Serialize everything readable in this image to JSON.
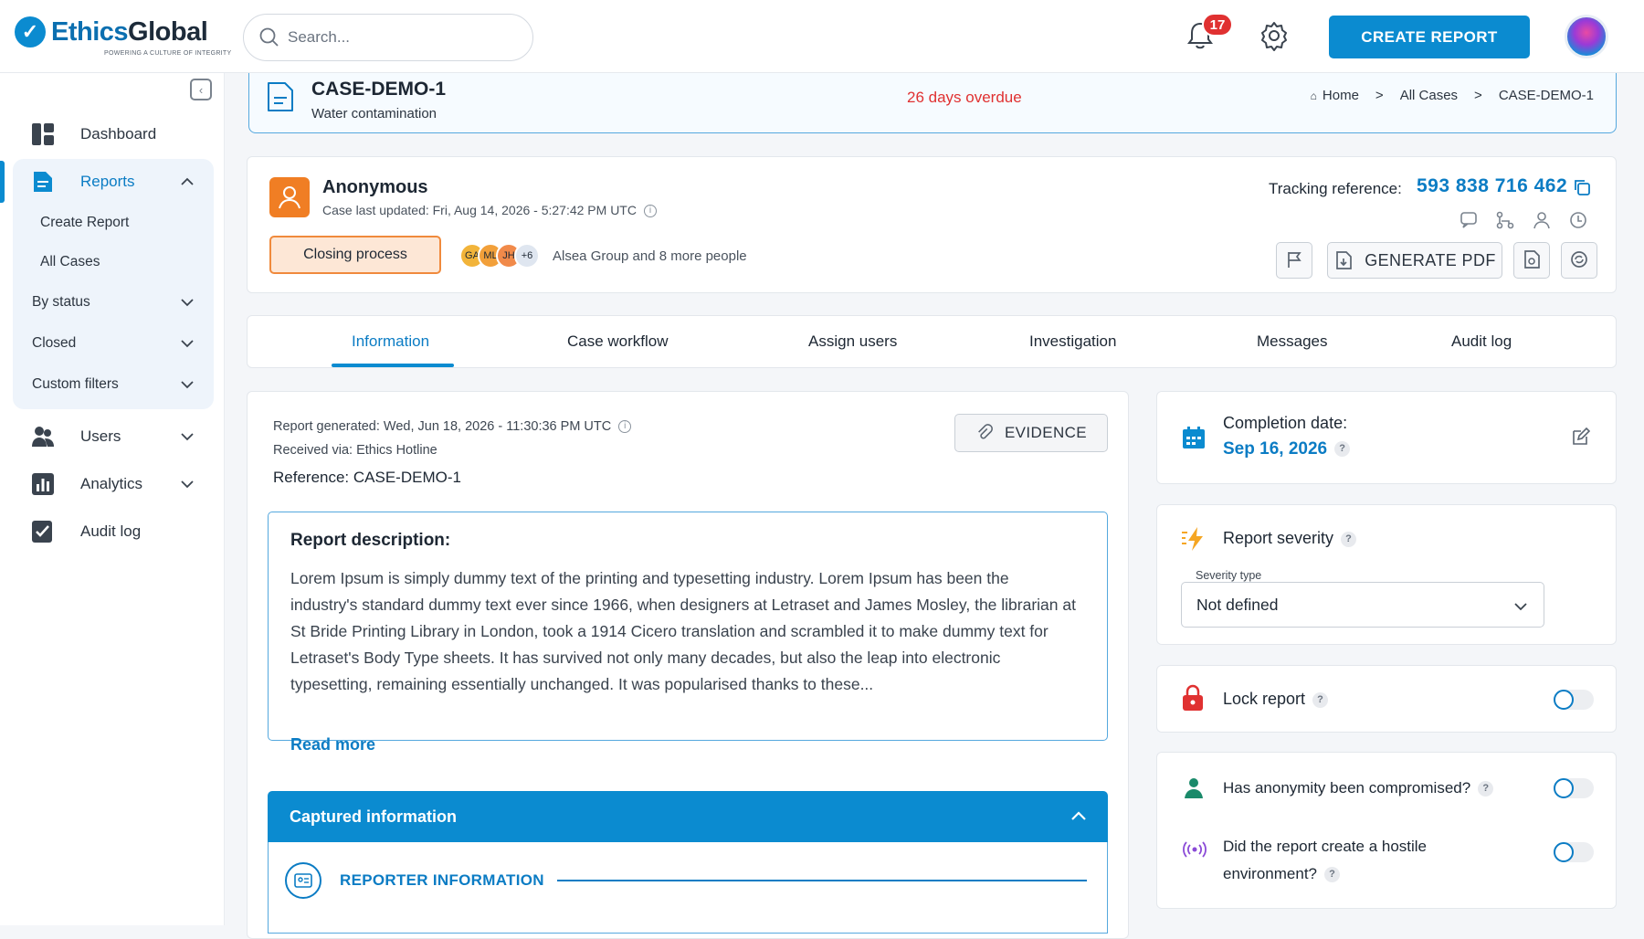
{
  "brand": {
    "name_a": "Ethics",
    "name_b": "Global",
    "tagline": "POWERING A CULTURE OF INTEGRITY"
  },
  "header": {
    "search_placeholder": "Search...",
    "notifications": "17",
    "create_report": "CREATE REPORT"
  },
  "sidebar": {
    "dashboard": "Dashboard",
    "reports": "Reports",
    "create_report": "Create Report",
    "all_cases": "All Cases",
    "by_status": "By status",
    "closed": "Closed",
    "custom_filters": "Custom filters",
    "users": "Users",
    "analytics": "Analytics",
    "audit_log": "Audit log"
  },
  "case": {
    "id": "CASE-DEMO-1",
    "subtitle": "Water contamination",
    "overdue": "26 days overdue",
    "breadcrumb": [
      "Home",
      ">",
      "All Cases",
      ">",
      "CASE-DEMO-1"
    ]
  },
  "summary": {
    "reporter": "Anonymous",
    "updated": "Case last updated: Fri, Aug 14, 2026 - 5:27:42 PM UTC",
    "status": "Closing process",
    "chips": [
      "GA",
      "ML",
      "JH",
      "+6"
    ],
    "people": "Alsea Group and 8 more people",
    "tracking_label": "Tracking reference:",
    "tracking_value": "593 838 716 462",
    "generate_pdf": "GENERATE PDF"
  },
  "tabs": [
    "Information",
    "Case workflow",
    "Assign users",
    "Investigation",
    "Messages",
    "Audit log"
  ],
  "info": {
    "generated": "Report generated: Wed, Jun 18, 2026 - 11:30:36 PM UTC",
    "received": "Received via: Ethics Hotline",
    "reference": "Reference: CASE-DEMO-1",
    "evidence": "EVIDENCE",
    "desc_title": "Report description:",
    "desc_text": "Lorem Ipsum is simply dummy text of the printing and typesetting industry. Lorem Ipsum has been the industry's standard dummy text ever since 1966, when designers at Letraset and James Mosley, the librarian at St Bride Printing Library in London, took a 1914 Cicero translation and scrambled it to make dummy text for Letraset's Body Type sheets. It has survived not only many decades, but also the leap into electronic typesetting, remaining essentially unchanged. It was popularised thanks to these...",
    "read_more": "Read more",
    "captured": "Captured information",
    "reporter_info": "REPORTER INFORMATION"
  },
  "side": {
    "completion_label": "Completion date:",
    "completion_value": "Sep 16, 2026",
    "severity_title": "Report severity",
    "severity_type": "Severity type",
    "severity_value": "Not defined",
    "lock": "Lock report",
    "anonymity": "Has anonymity been compromised?",
    "hostile_1": "Did the report create a hostile",
    "hostile_2": "environment?",
    "help": "?"
  },
  "colors": {
    "accent": "#0b8bd0",
    "overdue": "#e03131",
    "status_bg": "#fde7d6",
    "status_border": "#f08a3c"
  }
}
